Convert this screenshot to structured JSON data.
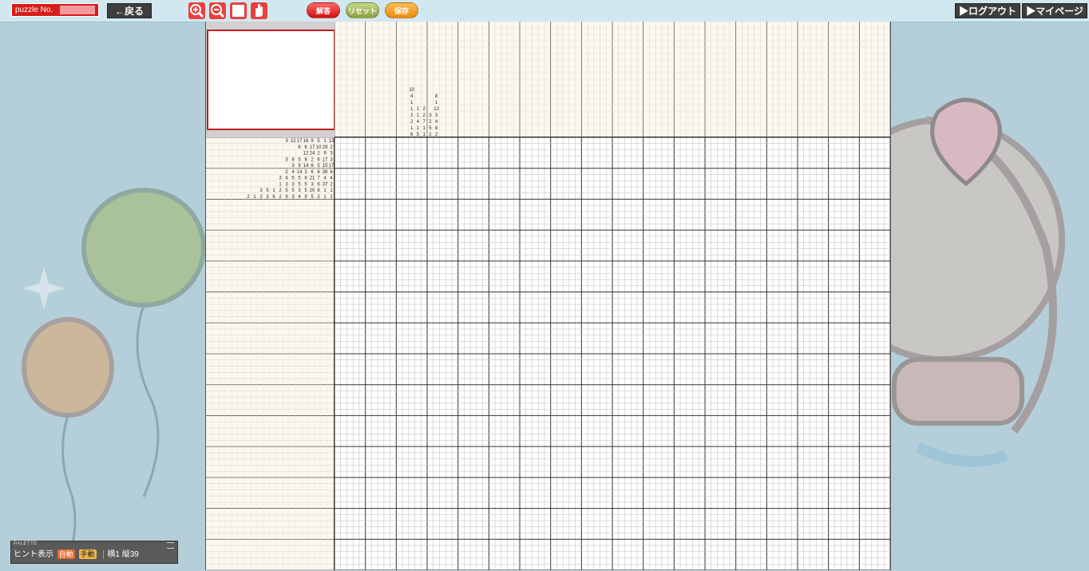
{
  "toolbar": {
    "puzzle_no_label": "puzzle No.",
    "back_label": "←戻る",
    "zoom_in_icon": "zoom-in-icon",
    "zoom_out_icon": "zoom-out-icon",
    "fill_icon": "white-square-icon",
    "pan_icon": "hand-icon",
    "answer_label": "解答",
    "reset_label": "リセット",
    "save_label": "保存",
    "logout_label": "▶ログアウト",
    "mypage_label": "▶マイページ"
  },
  "palette": {
    "title": "PALETTE",
    "hint_label": "ヒント表示",
    "auto_label": "自動",
    "manual_label": "手動",
    "position_label": "横1 縦39"
  },
  "puzzle": {
    "cols": 90,
    "rows": 70,
    "column_clues_sample": [
      [
        "10",
        "4",
        "1",
        "1",
        "2",
        "2",
        "1",
        "6"
      ],
      [
        "1",
        "1",
        "4",
        "1",
        "5"
      ],
      [
        "2",
        "2",
        "7",
        "1",
        "1"
      ],
      [
        "3",
        "2",
        "5",
        "2"
      ],
      [
        "8",
        "1",
        "12",
        "3",
        "4",
        "8",
        "2"
      ]
    ],
    "row_clues_sample": [
      [
        "3",
        "12",
        "17",
        "16",
        "9",
        "5",
        "1",
        "13"
      ],
      [
        "6",
        "6",
        "17",
        "10",
        "29",
        "2"
      ],
      [
        "12",
        "24",
        "2",
        "9",
        "3"
      ],
      [
        "3",
        "8",
        "5",
        "8",
        "2",
        "6",
        "17",
        "3"
      ],
      [
        "3",
        "9",
        "14",
        "6",
        "5",
        "15",
        "17"
      ],
      [
        "2",
        "4",
        "14",
        "3",
        "6",
        "6",
        "38",
        "6"
      ],
      [
        "3",
        "4",
        "5",
        "5",
        "8",
        "21",
        "7",
        "4",
        "4"
      ],
      [
        "1",
        "3",
        "3",
        "5",
        "5",
        "3",
        "6",
        "37",
        "2"
      ],
      [
        "3",
        "5",
        "1",
        "2",
        "5",
        "5",
        "3",
        "5",
        "20",
        "8",
        "1",
        "1"
      ],
      [
        "2",
        "1",
        "2",
        "3",
        "6",
        "2",
        "9",
        "3",
        "4",
        "9",
        "5",
        "2",
        "1",
        "2"
      ]
    ]
  },
  "colors": {
    "background": "#b4cfd9",
    "accent_red": "#c31d1d",
    "board_bg": "#fbf8ee"
  }
}
